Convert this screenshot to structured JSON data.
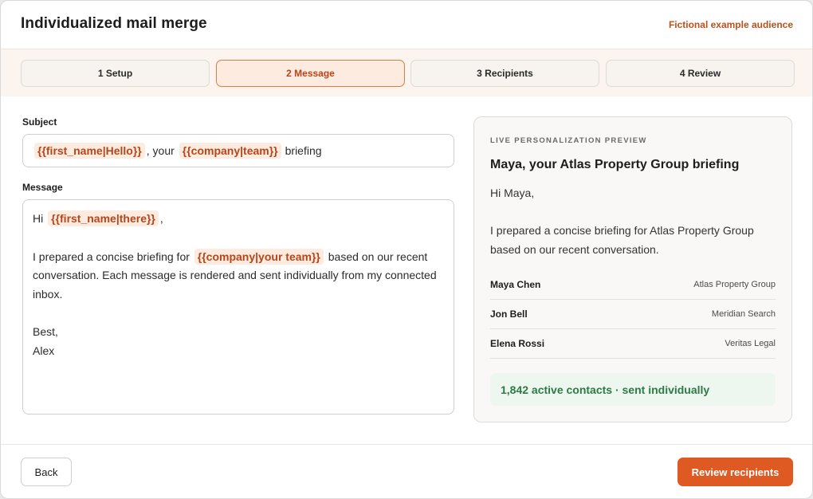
{
  "header": {
    "title": "Individualized mail merge",
    "audience_note": "Fictional example audience"
  },
  "steps": [
    {
      "label": "1 Setup",
      "active": false
    },
    {
      "label": "2 Message",
      "active": true
    },
    {
      "label": "3 Recipients",
      "active": false
    },
    {
      "label": "4 Review",
      "active": false
    }
  ],
  "subject": {
    "label": "Subject",
    "token_first_name": "{{first_name|Hello}}",
    "text_your": ", your",
    "token_company": "{{company|team}}",
    "text_briefing": "briefing"
  },
  "message": {
    "label": "Message",
    "hi": "Hi",
    "token_first_name": "{{first_name|there}}",
    "comma": ",",
    "p1_start": "I prepared a concise briefing for",
    "token_company": "{{company|your team}}",
    "p1_end": "based on our recent conversation. Each message is rendered and sent individually from my connected inbox.",
    "signoff": "Best,",
    "signature": "Alex"
  },
  "preview": {
    "eyebrow": "LIVE PERSONALIZATION PREVIEW",
    "subject": "Maya, your Atlas Property Group briefing",
    "greeting": "Hi Maya,",
    "body": "I prepared a concise briefing for Atlas Property Group based on our recent conversation.",
    "recipients": [
      {
        "name": "Maya Chen",
        "company": "Atlas Property Group"
      },
      {
        "name": "Jon Bell",
        "company": "Meridian Search"
      },
      {
        "name": "Elena Rossi",
        "company": "Veritas Legal"
      }
    ],
    "count_text": "1,842 active contacts · sent individually"
  },
  "footer": {
    "back_label": "Back",
    "review_label": "Review recipients"
  },
  "colors": {
    "accent": "#de5a22",
    "accent_text": "#b5461a",
    "success": "#2d7a45"
  }
}
